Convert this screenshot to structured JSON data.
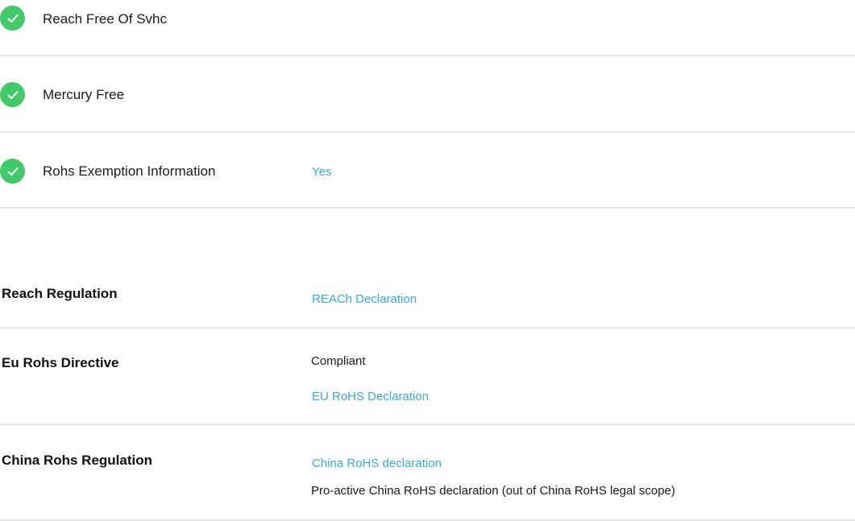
{
  "compliance_checks": [
    {
      "icon": "check-circle-icon",
      "label": "Reach Free Of Svhc",
      "value": ""
    },
    {
      "icon": "check-circle-icon",
      "label": "Mercury Free",
      "value": ""
    },
    {
      "icon": "check-circle-icon",
      "label": "Rohs Exemption Information",
      "value": "Yes"
    }
  ],
  "regulations": [
    {
      "label": "Reach Regulation",
      "link": "REACh Declaration"
    },
    {
      "label": "Eu Rohs Directive",
      "status": "Compliant",
      "link": "EU RoHS Declaration"
    },
    {
      "label": "China Rohs Regulation",
      "link": "China RoHS declaration",
      "note": "Pro-active China RoHS declaration (out of China RoHS legal scope)"
    }
  ],
  "colors": {
    "check_green": "#42c96a",
    "link_blue": "#3aa9dc",
    "divider": "#e6e6e6"
  }
}
